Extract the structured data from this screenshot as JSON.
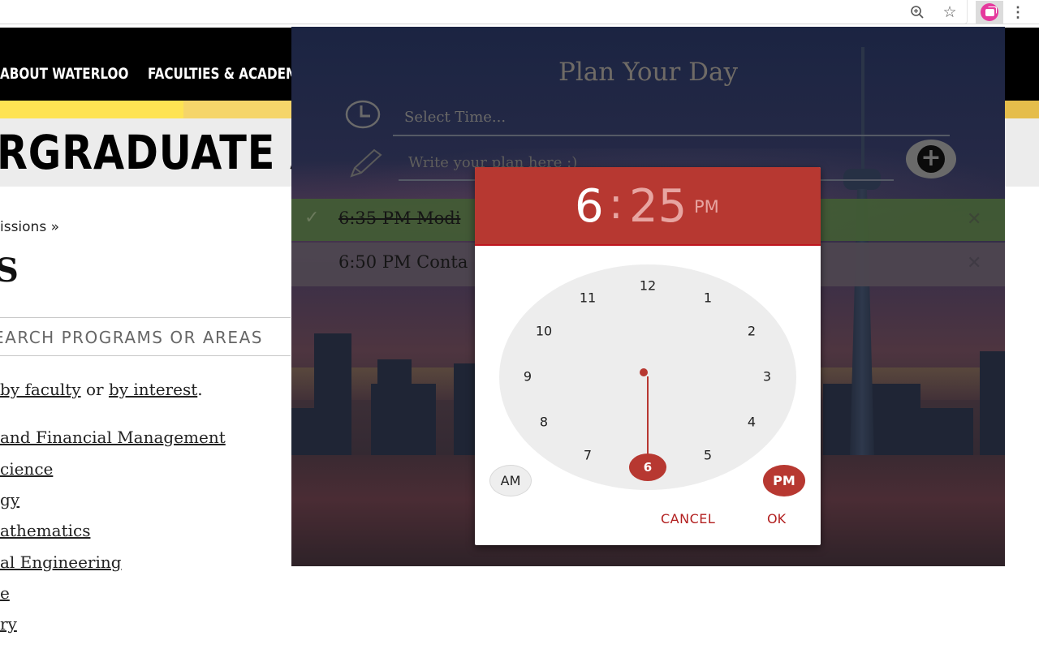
{
  "browser": {
    "toolbar_icons": [
      "zoom-icon",
      "star-icon",
      "extension-icon",
      "menu-icon"
    ]
  },
  "site": {
    "nav": {
      "items": [
        "ABOUT WATERLOO",
        "FACULTIES & ACADEM"
      ]
    },
    "page_title": "RGRADUATE AD",
    "breadcrumb": "issions »",
    "heading": "S",
    "search_placeholder": "EARCH PROGRAMS OR AREAS",
    "intro": {
      "prefix": " ",
      "link1": "by faculty",
      "middle": " or ",
      "link2": "by interest",
      "suffix": "."
    },
    "programs": [
      " and Financial Management",
      "cience",
      "gy",
      "athematics",
      "al Engineering",
      "e",
      "ry"
    ]
  },
  "popup": {
    "title": "Plan Your Day",
    "time_placeholder": "Select Time...",
    "plan_placeholder": "Write your plan here :)",
    "todos": [
      {
        "text": "6:35 PM Modi",
        "done": true
      },
      {
        "text": "6:50 PM Conta",
        "done": false
      }
    ]
  },
  "time_picker": {
    "hour": "6",
    "separator": ":",
    "minute": "25",
    "period": "PM",
    "selected_hour": "6",
    "dial_numbers": [
      "12",
      "1",
      "2",
      "3",
      "4",
      "5",
      "7",
      "8",
      "9",
      "10",
      "11"
    ],
    "am_label": "AM",
    "pm_label": "PM",
    "cancel_label": "CANCEL",
    "ok_label": "OK",
    "accent_color": "#b73831"
  }
}
